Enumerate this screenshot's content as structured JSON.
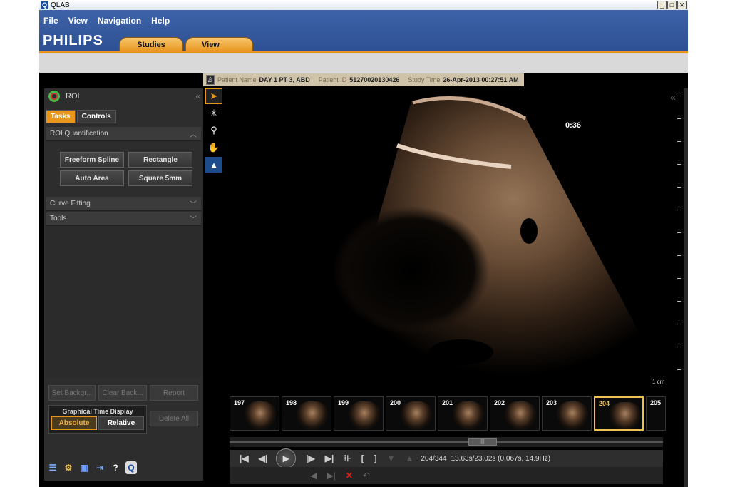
{
  "window": {
    "title": "QLAB",
    "app_icon": "Q"
  },
  "menu": [
    "File",
    "View",
    "Navigation",
    "Help"
  ],
  "brand": "PHILIPS",
  "tabs": {
    "studies": "Studies",
    "view": "View"
  },
  "banner": {
    "patient_name_label": "Patient Name",
    "patient_name": "DAY 1 PT 3, ABD",
    "patient_id_label": "Patient ID",
    "patient_id": "51270020130426",
    "study_time_label": "Study Time",
    "study_time": "26-Apr-2013 00:27:51 AM"
  },
  "panel": {
    "title": "ROI",
    "tabs": {
      "tasks": "Tasks",
      "controls": "Controls"
    },
    "sections": {
      "roi_quant": "ROI Quantification",
      "curve_fitting": "Curve Fitting",
      "tools": "Tools"
    },
    "roi_buttons": {
      "freeform": "Freeform Spline",
      "rectangle": "Rectangle",
      "auto_area": "Auto Area",
      "square": "Square 5mm"
    },
    "bottom": {
      "set_background": "Set Backgr...",
      "clear_background": "Clear Back...",
      "report": "Report",
      "graphical_time_display": "Graphical Time Display",
      "absolute": "Absolute",
      "relative": "Relative",
      "delete_all": "Delete All"
    }
  },
  "viewport": {
    "timer": "0:36",
    "scale_label": "1 cm"
  },
  "thumbnails": [
    {
      "frame": "197"
    },
    {
      "frame": "198"
    },
    {
      "frame": "199"
    },
    {
      "frame": "200"
    },
    {
      "frame": "201"
    },
    {
      "frame": "202"
    },
    {
      "frame": "203"
    },
    {
      "frame": "204"
    },
    {
      "frame": "205"
    }
  ],
  "transport": {
    "frame_info": "204/344",
    "time_info": "13.63s/23.02s (0.067s, 14.9Hz)"
  },
  "colors": {
    "accent": "#e8951c",
    "header_blue": "#2c4f93"
  }
}
